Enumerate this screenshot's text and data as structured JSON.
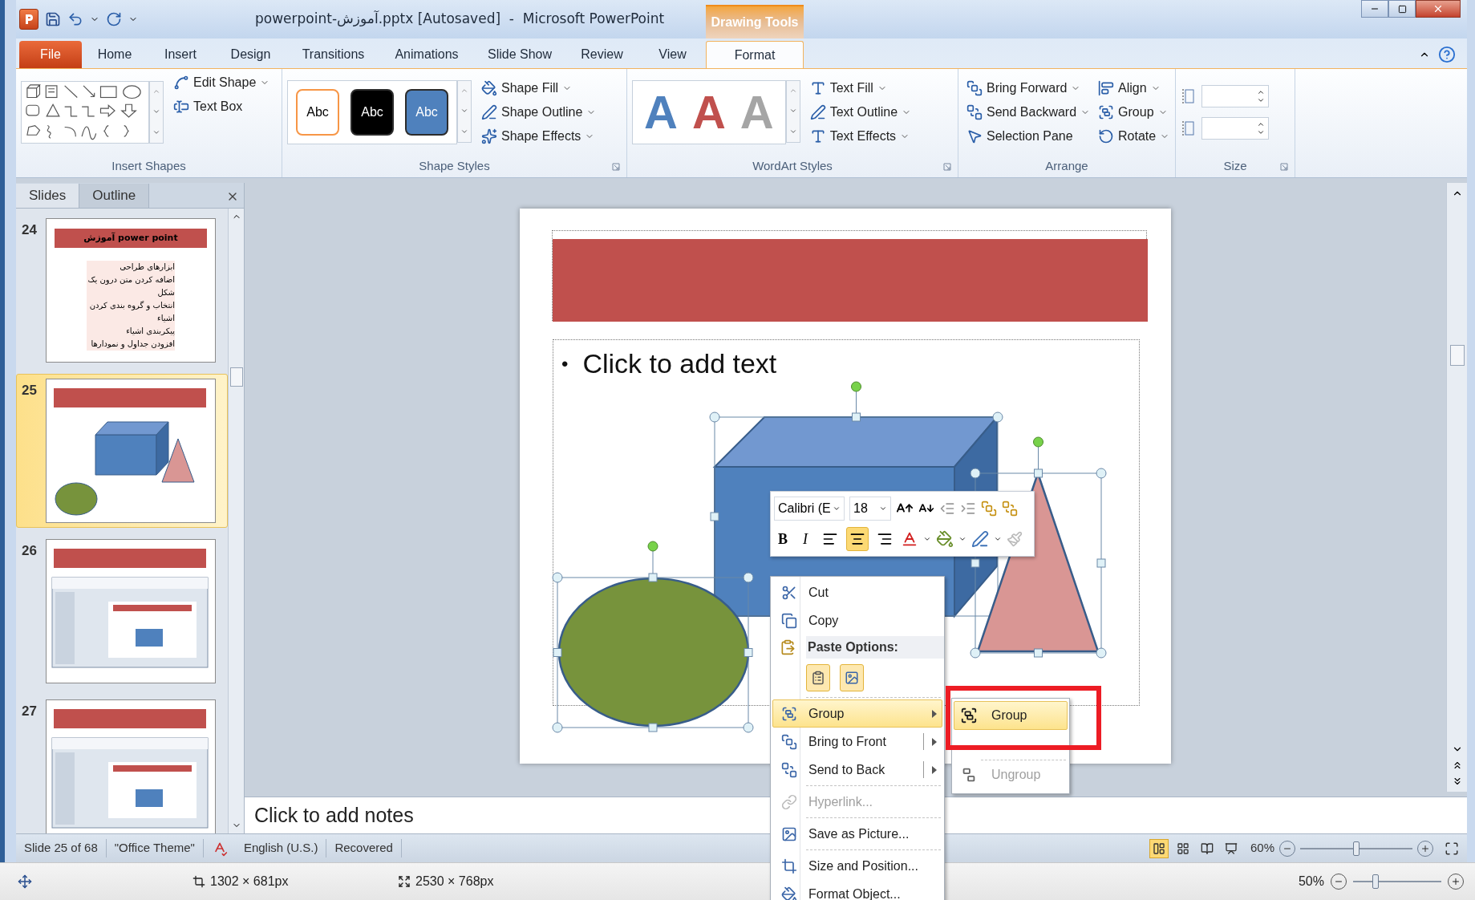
{
  "window": {
    "title": "powerpoint-آموزش.pptx [Autosaved]  -  Microsoft PowerPoint",
    "context_group": "Drawing Tools"
  },
  "ribbon_tabs": [
    {
      "label": "File",
      "kind": "file",
      "selected": false
    },
    {
      "label": "Home",
      "kind": "tab",
      "selected": false
    },
    {
      "label": "Insert",
      "kind": "tab",
      "selected": false
    },
    {
      "label": "Design",
      "kind": "tab",
      "selected": false
    },
    {
      "label": "Transitions",
      "kind": "tab",
      "selected": false
    },
    {
      "label": "Animations",
      "kind": "tab",
      "selected": false
    },
    {
      "label": "Slide Show",
      "kind": "tab",
      "selected": false
    },
    {
      "label": "Review",
      "kind": "tab",
      "selected": false
    },
    {
      "label": "View",
      "kind": "tab",
      "selected": false
    },
    {
      "label": "Format",
      "kind": "context",
      "selected": true
    }
  ],
  "ribbon_groups": [
    {
      "kind": "insert_shapes",
      "label": "Insert Shapes",
      "launcher": false,
      "commands": [
        {
          "label": "Edit Shape",
          "dropdown": true
        },
        {
          "label": "Text Box",
          "dropdown": false
        }
      ]
    },
    {
      "kind": "shape_styles",
      "label": "Shape Styles",
      "launcher": true,
      "swatches": [
        {
          "label": "Abc",
          "color": "#ffffff"
        },
        {
          "label": "Abc",
          "color": "#000000"
        },
        {
          "label": "Abc",
          "color": "#4f81bd"
        }
      ],
      "commands": [
        {
          "label": "Shape Fill",
          "dropdown": true
        },
        {
          "label": "Shape Outline",
          "dropdown": true
        },
        {
          "label": "Shape Effects",
          "dropdown": true
        }
      ]
    },
    {
      "kind": "wordart",
      "label": "WordArt Styles",
      "launcher": true,
      "swatches": [
        {
          "label": "A",
          "color": "#4f81bd"
        },
        {
          "label": "A",
          "color": "#c0504d"
        },
        {
          "label": "A",
          "color": "#a5a5a5"
        }
      ],
      "commands": [
        {
          "label": "Text Fill",
          "dropdown": true
        },
        {
          "label": "Text Outline",
          "dropdown": true
        },
        {
          "label": "Text Effects",
          "dropdown": true
        }
      ]
    },
    {
      "kind": "arrange",
      "label": "Arrange",
      "launcher": false,
      "commands": [
        {
          "label": "Bring Forward",
          "dropdown": true
        },
        {
          "label": "Send Backward",
          "dropdown": true
        },
        {
          "label": "Selection Pane",
          "dropdown": false
        },
        {
          "label": "Align",
          "dropdown": true
        },
        {
          "label": "Group",
          "dropdown": true
        },
        {
          "label": "Rotate",
          "dropdown": true
        }
      ]
    },
    {
      "kind": "size",
      "label": "Size",
      "launcher": true
    }
  ],
  "pane_tabs": [
    {
      "label": "Slides",
      "selected": true
    },
    {
      "label": "Outline",
      "selected": false
    }
  ],
  "slides": [
    {
      "number": "24",
      "kind": "text",
      "selected": false,
      "title": "آموزش power point",
      "lines": [
        "ابزارهای طراحی",
        "اضافه کردن متن درون یک شکل",
        "انتخاب و گروه بندی کردن اشیاء",
        "پیکربندی اشیاء",
        "افزودن جداول و نمودارها"
      ]
    },
    {
      "number": "25",
      "kind": "shapes",
      "selected": true
    },
    {
      "number": "26",
      "kind": "screenshot",
      "selected": false
    },
    {
      "number": "27",
      "kind": "screenshot",
      "selected": false
    }
  ],
  "slide": {
    "bullet": "•",
    "body_placeholder": "Click to add text"
  },
  "notes": {
    "placeholder": "Click to add notes"
  },
  "mini_toolbar": {
    "font": "Calibri (E",
    "size": "18",
    "bold": "B",
    "italic": "I",
    "alignments": [
      {
        "selected": false
      },
      {
        "selected": true
      },
      {
        "selected": false
      }
    ]
  },
  "context_menu": [
    {
      "kind": "item",
      "label": "Cut",
      "disabled": false,
      "selected": false,
      "submenu": false,
      "split": false
    },
    {
      "kind": "item",
      "label": "Copy",
      "disabled": false,
      "selected": false,
      "submenu": false,
      "split": false
    },
    {
      "kind": "header",
      "label": "Paste Options:"
    },
    {
      "kind": "paste_buttons"
    },
    {
      "kind": "separator"
    },
    {
      "kind": "item",
      "label": "Group",
      "disabled": false,
      "selected": true,
      "submenu": true,
      "split": false
    },
    {
      "kind": "item",
      "label": "Bring to Front",
      "disabled": false,
      "selected": false,
      "submenu": true,
      "split": true
    },
    {
      "kind": "item",
      "label": "Send to Back",
      "disabled": false,
      "selected": false,
      "submenu": true,
      "split": true
    },
    {
      "kind": "separator"
    },
    {
      "kind": "item",
      "label": "Hyperlink...",
      "disabled": true,
      "selected": false,
      "submenu": false,
      "split": false
    },
    {
      "kind": "separator"
    },
    {
      "kind": "item",
      "label": "Save as Picture...",
      "disabled": false,
      "selected": false,
      "submenu": false,
      "split": false
    },
    {
      "kind": "separator"
    },
    {
      "kind": "item",
      "label": "Size and Position...",
      "disabled": false,
      "selected": false,
      "submenu": false,
      "split": false
    },
    {
      "kind": "item",
      "label": "Format Object...",
      "disabled": false,
      "selected": false,
      "submenu": false,
      "split": false
    }
  ],
  "submenu": [
    {
      "label": "Group",
      "selected": true,
      "disabled": false
    },
    {
      "label": "Ungroup",
      "selected": false,
      "disabled": true
    }
  ],
  "status_bar": {
    "fields": [
      "Slide 25 of 68",
      "\"Office Theme\"",
      "English (U.S.)",
      "Recovered"
    ],
    "views": [
      {
        "selected": true
      },
      {
        "selected": false
      },
      {
        "selected": false
      },
      {
        "selected": false
      }
    ],
    "zoom": "60%",
    "zoom_level": {
      "level": 0.5
    }
  },
  "editor_bar": {
    "selection_size": "1302 × 681px",
    "image_size": "2530 × 768px",
    "zoom": "50%",
    "zoom_level": {
      "level": 0.25
    }
  }
}
